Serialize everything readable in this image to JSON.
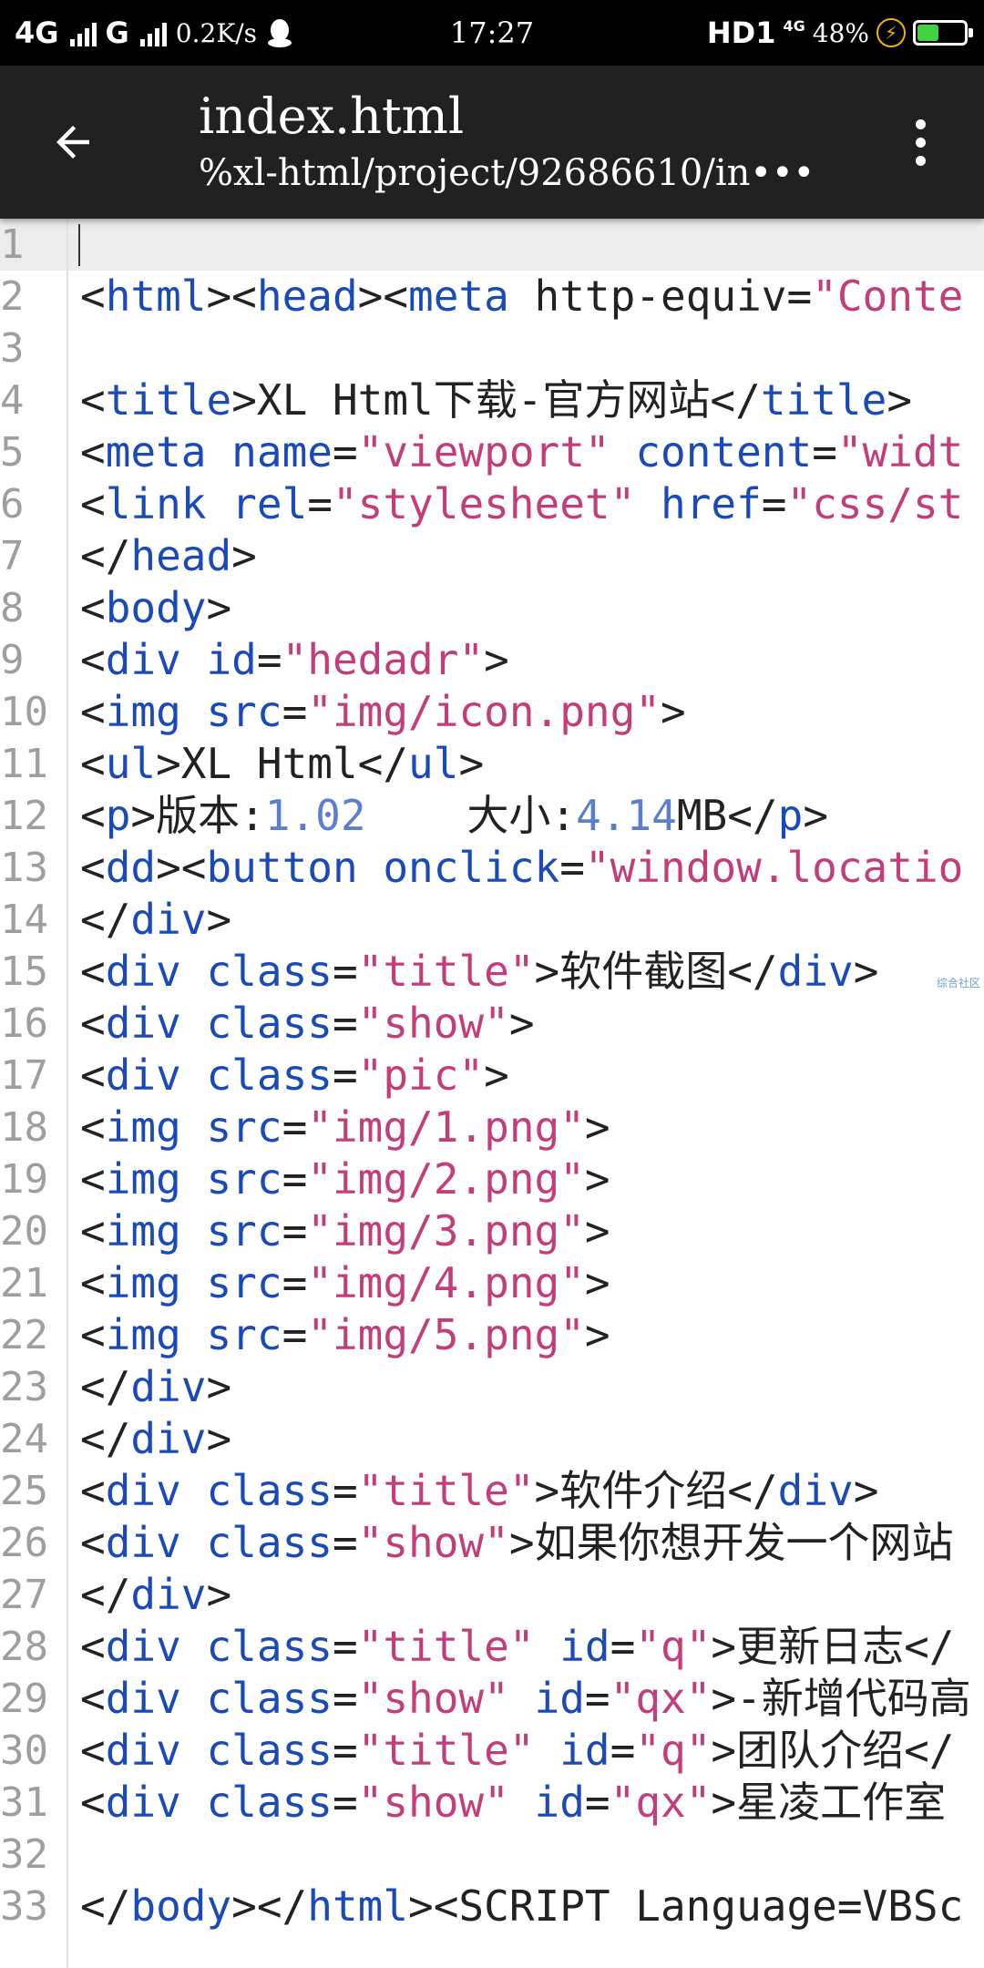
{
  "status_bar": {
    "network": "4G",
    "network2": "G",
    "speed": "0.2K/s",
    "time": "17:27",
    "hd": "HD1",
    "net_type": "4G",
    "battery": "48%",
    "battery_level": 0.48,
    "battery_color": "#3fd43f"
  },
  "app_bar": {
    "title": "index.html",
    "subtitle": "%xl-html/project/92686610/in•••",
    "back_icon": "arrow-left-icon",
    "menu_icon": "more-vert-icon"
  },
  "editor": {
    "current_line": 1,
    "watermark": "综合社区",
    "lines": [
      {
        "n": "1",
        "t": []
      },
      {
        "n": "2",
        "t": [
          [
            "p",
            "<"
          ],
          [
            "t",
            "html"
          ],
          [
            "p",
            "><"
          ],
          [
            "t",
            "head"
          ],
          [
            "p",
            "><"
          ],
          [
            "t",
            "meta"
          ],
          [
            "p",
            " http-equiv="
          ],
          [
            "s",
            "\"Conte"
          ]
        ]
      },
      {
        "n": "3",
        "t": []
      },
      {
        "n": "4",
        "t": [
          [
            "p",
            "<"
          ],
          [
            "t",
            "title"
          ],
          [
            "p",
            ">XL Html下载-官方网站</"
          ],
          [
            "t",
            "title"
          ],
          [
            "p",
            ">"
          ]
        ]
      },
      {
        "n": "5",
        "t": [
          [
            "p",
            "<"
          ],
          [
            "t",
            "meta name"
          ],
          [
            "p",
            "="
          ],
          [
            "s",
            "\"viewport\""
          ],
          [
            "p",
            " "
          ],
          [
            "t",
            "content"
          ],
          [
            "p",
            "="
          ],
          [
            "s",
            "\"widt"
          ]
        ]
      },
      {
        "n": "6",
        "t": [
          [
            "p",
            "<"
          ],
          [
            "t",
            "link rel"
          ],
          [
            "p",
            "="
          ],
          [
            "s",
            "\"stylesheet\""
          ],
          [
            "p",
            " "
          ],
          [
            "t",
            "href"
          ],
          [
            "p",
            "="
          ],
          [
            "s",
            "\"css/st"
          ]
        ]
      },
      {
        "n": "7",
        "t": [
          [
            "p",
            "</"
          ],
          [
            "t",
            "head"
          ],
          [
            "p",
            ">"
          ]
        ]
      },
      {
        "n": "8",
        "t": [
          [
            "p",
            "<"
          ],
          [
            "t",
            "body"
          ],
          [
            "p",
            ">"
          ]
        ]
      },
      {
        "n": "9",
        "t": [
          [
            "p",
            "<"
          ],
          [
            "t",
            "div id"
          ],
          [
            "p",
            "="
          ],
          [
            "s",
            "\"hedadr\""
          ],
          [
            "p",
            ">"
          ]
        ]
      },
      {
        "n": "10",
        "t": [
          [
            "p",
            "<"
          ],
          [
            "t",
            "img src"
          ],
          [
            "p",
            "="
          ],
          [
            "s",
            "\"img/icon.png\""
          ],
          [
            "p",
            ">"
          ]
        ]
      },
      {
        "n": "11",
        "t": [
          [
            "p",
            "<"
          ],
          [
            "t",
            "ul"
          ],
          [
            "p",
            ">XL Html</"
          ],
          [
            "t",
            "ul"
          ],
          [
            "p",
            ">"
          ]
        ]
      },
      {
        "n": "12",
        "t": [
          [
            "p",
            "<"
          ],
          [
            "t",
            "p"
          ],
          [
            "p",
            ">版本:"
          ],
          [
            "n",
            "1.02"
          ],
          [
            "p",
            "    大小:"
          ],
          [
            "n",
            "4.14"
          ],
          [
            "p",
            "MB</"
          ],
          [
            "t",
            "p"
          ],
          [
            "p",
            ">"
          ]
        ]
      },
      {
        "n": "13",
        "t": [
          [
            "p",
            "<"
          ],
          [
            "t",
            "dd"
          ],
          [
            "p",
            "><"
          ],
          [
            "t",
            "button onclick"
          ],
          [
            "p",
            "="
          ],
          [
            "s",
            "\"window.locatio"
          ]
        ]
      },
      {
        "n": "14",
        "t": [
          [
            "p",
            "</"
          ],
          [
            "t",
            "div"
          ],
          [
            "p",
            ">"
          ]
        ]
      },
      {
        "n": "15",
        "t": [
          [
            "p",
            "<"
          ],
          [
            "t",
            "div class"
          ],
          [
            "p",
            "="
          ],
          [
            "s",
            "\"title\""
          ],
          [
            "p",
            ">软件截图</"
          ],
          [
            "t",
            "div"
          ],
          [
            "p",
            ">"
          ]
        ]
      },
      {
        "n": "16",
        "t": [
          [
            "p",
            "<"
          ],
          [
            "t",
            "div class"
          ],
          [
            "p",
            "="
          ],
          [
            "s",
            "\"show\""
          ],
          [
            "p",
            ">"
          ]
        ]
      },
      {
        "n": "17",
        "t": [
          [
            "p",
            "<"
          ],
          [
            "t",
            "div class"
          ],
          [
            "p",
            "="
          ],
          [
            "s",
            "\"pic\""
          ],
          [
            "p",
            ">"
          ]
        ]
      },
      {
        "n": "18",
        "t": [
          [
            "p",
            "<"
          ],
          [
            "t",
            "img src"
          ],
          [
            "p",
            "="
          ],
          [
            "s",
            "\"img/1.png\""
          ],
          [
            "p",
            ">"
          ]
        ]
      },
      {
        "n": "19",
        "t": [
          [
            "p",
            "<"
          ],
          [
            "t",
            "img src"
          ],
          [
            "p",
            "="
          ],
          [
            "s",
            "\"img/2.png\""
          ],
          [
            "p",
            ">"
          ]
        ]
      },
      {
        "n": "20",
        "t": [
          [
            "p",
            "<"
          ],
          [
            "t",
            "img src"
          ],
          [
            "p",
            "="
          ],
          [
            "s",
            "\"img/3.png\""
          ],
          [
            "p",
            ">"
          ]
        ]
      },
      {
        "n": "21",
        "t": [
          [
            "p",
            "<"
          ],
          [
            "t",
            "img src"
          ],
          [
            "p",
            "="
          ],
          [
            "s",
            "\"img/4.png\""
          ],
          [
            "p",
            ">"
          ]
        ]
      },
      {
        "n": "22",
        "t": [
          [
            "p",
            "<"
          ],
          [
            "t",
            "img src"
          ],
          [
            "p",
            "="
          ],
          [
            "s",
            "\"img/5.png\""
          ],
          [
            "p",
            ">"
          ]
        ]
      },
      {
        "n": "23",
        "t": [
          [
            "p",
            "</"
          ],
          [
            "t",
            "div"
          ],
          [
            "p",
            ">"
          ]
        ]
      },
      {
        "n": "24",
        "t": [
          [
            "p",
            "</"
          ],
          [
            "t",
            "div"
          ],
          [
            "p",
            ">"
          ]
        ]
      },
      {
        "n": "25",
        "t": [
          [
            "p",
            "<"
          ],
          [
            "t",
            "div class"
          ],
          [
            "p",
            "="
          ],
          [
            "s",
            "\"title\""
          ],
          [
            "p",
            ">软件介绍</"
          ],
          [
            "t",
            "div"
          ],
          [
            "p",
            ">"
          ]
        ]
      },
      {
        "n": "26",
        "t": [
          [
            "p",
            "<"
          ],
          [
            "t",
            "div class"
          ],
          [
            "p",
            "="
          ],
          [
            "s",
            "\"show\""
          ],
          [
            "p",
            ">如果你想开发一个网站"
          ]
        ]
      },
      {
        "n": "27",
        "t": [
          [
            "p",
            "</"
          ],
          [
            "t",
            "div"
          ],
          [
            "p",
            ">"
          ]
        ]
      },
      {
        "n": "28",
        "t": [
          [
            "p",
            "<"
          ],
          [
            "t",
            "div class"
          ],
          [
            "p",
            "="
          ],
          [
            "s",
            "\"title\""
          ],
          [
            "p",
            " "
          ],
          [
            "t",
            "id"
          ],
          [
            "p",
            "="
          ],
          [
            "s",
            "\"q\""
          ],
          [
            "p",
            ">更新日志</"
          ]
        ]
      },
      {
        "n": "29",
        "t": [
          [
            "p",
            "<"
          ],
          [
            "t",
            "div class"
          ],
          [
            "p",
            "="
          ],
          [
            "s",
            "\"show\""
          ],
          [
            "p",
            " "
          ],
          [
            "t",
            "id"
          ],
          [
            "p",
            "="
          ],
          [
            "s",
            "\"qx\""
          ],
          [
            "p",
            ">-新增代码高"
          ]
        ]
      },
      {
        "n": "30",
        "t": [
          [
            "p",
            "<"
          ],
          [
            "t",
            "div class"
          ],
          [
            "p",
            "="
          ],
          [
            "s",
            "\"title\""
          ],
          [
            "p",
            " "
          ],
          [
            "t",
            "id"
          ],
          [
            "p",
            "="
          ],
          [
            "s",
            "\"q\""
          ],
          [
            "p",
            ">团队介绍</"
          ]
        ]
      },
      {
        "n": "31",
        "t": [
          [
            "p",
            "<"
          ],
          [
            "t",
            "div class"
          ],
          [
            "p",
            "="
          ],
          [
            "s",
            "\"show\""
          ],
          [
            "p",
            " "
          ],
          [
            "t",
            "id"
          ],
          [
            "p",
            "="
          ],
          [
            "s",
            "\"qx\""
          ],
          [
            "p",
            ">星凌工作室"
          ]
        ]
      },
      {
        "n": "32",
        "t": []
      },
      {
        "n": "33",
        "t": [
          [
            "p",
            "</"
          ],
          [
            "t",
            "body"
          ],
          [
            "p",
            "></"
          ],
          [
            "t",
            "html"
          ],
          [
            "p",
            "><SCRIPT Language=VBSc"
          ]
        ]
      }
    ]
  }
}
